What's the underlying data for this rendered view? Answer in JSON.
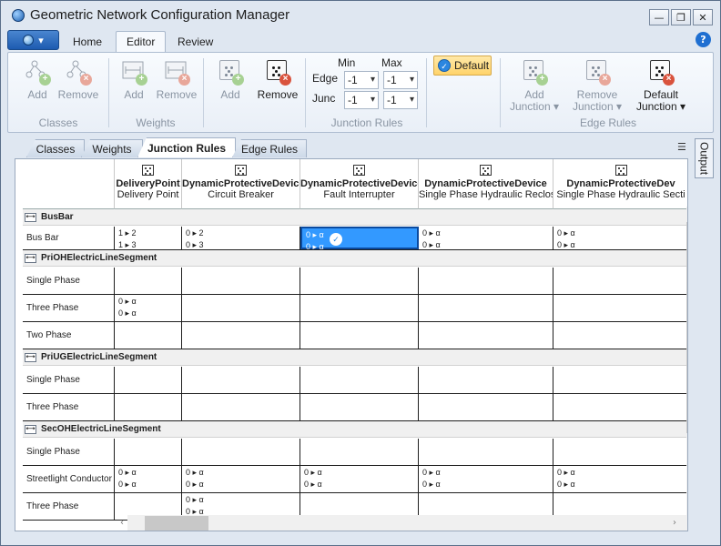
{
  "window": {
    "title": "Geometric Network Configuration Manager",
    "buttons": [
      "—",
      "❐",
      "✕"
    ]
  },
  "menu": {
    "tabs": [
      "Home",
      "Editor",
      "Review"
    ],
    "active": "Editor",
    "help": "?"
  },
  "ribbon": {
    "classes": {
      "label": "Classes",
      "add": "Add",
      "remove": "Remove"
    },
    "weights": {
      "label": "Weights",
      "add": "Add",
      "remove": "Remove"
    },
    "junction": {
      "add": "Add",
      "remove": "Remove"
    },
    "junction_rules": {
      "label": "Junction Rules",
      "min_label": "Min",
      "max_label": "Max",
      "edge_label": "Edge",
      "junc_label": "Junc",
      "edge_min": "-1",
      "edge_max": "-1",
      "junc_min": "-1",
      "junc_max": "-1",
      "default": "Default"
    },
    "edge_rules": {
      "label": "Edge Rules",
      "add_l1": "Add",
      "add_l2": "Junction",
      "remove_l1": "Remove",
      "remove_l2": "Junction",
      "default_l1": "Default",
      "default_l2": "Junction"
    }
  },
  "doc_tabs": [
    "Classes",
    "Weights",
    "Junction Rules",
    "Edge Rules"
  ],
  "active_doc_tab": "Junction Rules",
  "output_tab": "Output",
  "columns": [
    {
      "h1": "DeliveryPoint",
      "h2": "Delivery Point"
    },
    {
      "h1": "DynamicProtectiveDevice",
      "h2": "Circuit Breaker"
    },
    {
      "h1": "DynamicProtectiveDevice",
      "h2": "Fault Interrupter"
    },
    {
      "h1": "DynamicProtectiveDevice",
      "h2": "Single Phase Hydraulic Recloser"
    },
    {
      "h1": "DynamicProtectiveDev",
      "h2": "Single Phase Hydraulic Secti"
    }
  ],
  "groups": [
    {
      "name": "BusBar",
      "rows": [
        {
          "label": "Bus Bar",
          "cells": [
            [
              "1 ▸ 2",
              "1 ▸ 3"
            ],
            [
              "0 ▸ 2",
              "0 ▸ 3"
            ],
            [
              "0 ▸ α",
              "0 ▸ α"
            ],
            [
              "0 ▸ α",
              "0 ▸ α"
            ],
            [
              "0 ▸ α",
              "0 ▸ α"
            ]
          ]
        }
      ]
    },
    {
      "name": "PriOHElectricLineSegment",
      "rows": [
        {
          "label": "Single Phase",
          "cells": [
            [],
            [],
            [],
            [],
            []
          ]
        },
        {
          "label": "Three Phase",
          "cells": [
            [
              "0 ▸ α",
              "0 ▸ α"
            ],
            [],
            [],
            [],
            []
          ]
        },
        {
          "label": "Two Phase",
          "cells": [
            [],
            [],
            [],
            [],
            []
          ]
        }
      ]
    },
    {
      "name": "PriUGElectricLineSegment",
      "rows": [
        {
          "label": "Single Phase",
          "cells": [
            [],
            [],
            [],
            [],
            []
          ]
        },
        {
          "label": "Three Phase",
          "cells": [
            [],
            [],
            [],
            [],
            []
          ]
        }
      ]
    },
    {
      "name": "SecOHElectricLineSegment",
      "rows": [
        {
          "label": "Single Phase",
          "cells": [
            [],
            [],
            [],
            [],
            []
          ]
        },
        {
          "label": "Streetlight Conductor",
          "cells": [
            [
              "0 ▸ α",
              "0 ▸ α"
            ],
            [
              "0 ▸ α",
              "0 ▸ α"
            ],
            [
              "0 ▸ α",
              "0 ▸ α"
            ],
            [
              "0 ▸ α",
              "0 ▸ α"
            ],
            [
              "0 ▸ α",
              "0 ▸ α"
            ]
          ]
        },
        {
          "label": "Three Phase",
          "cells": [
            [],
            [
              "0 ▸ α",
              "0 ▸ α"
            ],
            [],
            [],
            []
          ]
        }
      ]
    }
  ]
}
